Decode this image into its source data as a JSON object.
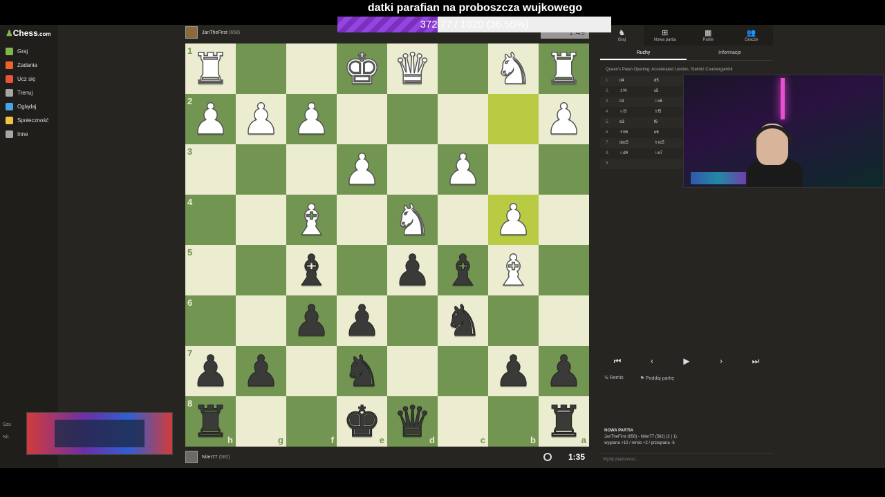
{
  "overlay": {
    "donation_title": "datki parafian na proboszcza wujkowego",
    "donation_progress_text": "372.77 / 1020 (36.55%)",
    "donation_progress_fraction": 0.3655
  },
  "sidebar": {
    "logo_prefix": "Chess",
    "logo_suffix": ".com",
    "items": [
      {
        "label": "Graj",
        "icon": "play-icon",
        "color": "#81b64c"
      },
      {
        "label": "Zadania",
        "icon": "puzzle-icon",
        "color": "#f1612a"
      },
      {
        "label": "Ucz się",
        "icon": "learn-icon",
        "color": "#e8533b"
      },
      {
        "label": "Trenuj",
        "icon": "train-icon",
        "color": "#a6a6a6"
      },
      {
        "label": "Oglądaj",
        "icon": "watch-icon",
        "color": "#4ca3e1"
      },
      {
        "label": "Społeczność",
        "icon": "community-icon",
        "color": "#efc34a"
      },
      {
        "label": "Inne",
        "icon": "more-icon",
        "color": "#a6a6a6"
      }
    ],
    "bottom": [
      "Szu",
      "Nit"
    ]
  },
  "top_player": {
    "name": "JanTheFirst",
    "rating": "(658)",
    "clock": "1:49"
  },
  "bottom_player": {
    "name": "Niter77",
    "rating": "(582)",
    "clock": "1:35"
  },
  "board": {
    "ranks": [
      "1",
      "2",
      "3",
      "4",
      "5",
      "6",
      "7",
      "8"
    ],
    "files": [
      "h",
      "g",
      "f",
      "e",
      "d",
      "c",
      "b",
      "a"
    ],
    "highlight": [
      [
        1,
        6
      ],
      [
        3,
        6
      ]
    ],
    "pieces": [
      [
        "wR",
        "",
        "",
        "wK",
        "wQ",
        "",
        "wN",
        "wR"
      ],
      [
        "wP",
        "wP",
        "wP",
        "",
        "",
        "",
        "",
        "wP"
      ],
      [
        "",
        "",
        "",
        "wP",
        "",
        "wP",
        "",
        ""
      ],
      [
        "",
        "",
        "wB",
        "",
        "wN",
        "",
        "wP",
        ""
      ],
      [
        "",
        "",
        "bB",
        "",
        "bP",
        "bB",
        "wB",
        ""
      ],
      [
        "",
        "",
        "bP",
        "bP",
        "",
        "bN",
        "",
        ""
      ],
      [
        "bP",
        "bP",
        "",
        "bN",
        "",
        "",
        "bP",
        "bP"
      ],
      [
        "bR",
        "",
        "",
        "bK",
        "bQ",
        "",
        "",
        "bR"
      ]
    ]
  },
  "panel": {
    "tabs": [
      {
        "label": "Graj",
        "icon": "play-icon"
      },
      {
        "label": "Nowa partia",
        "icon": "plus-icon"
      },
      {
        "label": "Partie",
        "icon": "games-icon"
      },
      {
        "label": "Gracze",
        "icon": "players-icon"
      }
    ],
    "subtabs": [
      "Ruchy",
      "Informacje"
    ],
    "opening": "Queen's Pawn Opening: Accelerated London, Steinitz Countergambit",
    "moves": [
      {
        "n": "1.",
        "w": "d4",
        "b": "d5"
      },
      {
        "n": "2.",
        "w": "♗f4",
        "b": "c5"
      },
      {
        "n": "3.",
        "w": "c3",
        "b": "♘c6"
      },
      {
        "n": "4.",
        "w": "♘f3",
        "b": "♗f5"
      },
      {
        "n": "5.",
        "w": "e3",
        "b": "f6"
      },
      {
        "n": "6.",
        "w": "♗b5",
        "b": "e6"
      },
      {
        "n": "7.",
        "w": "dxc5",
        "b": "♗xc5"
      },
      {
        "n": "8.",
        "w": "♘d4",
        "b": "♘e7"
      },
      {
        "n": "9.",
        "w": "",
        "b": ""
      }
    ],
    "controls": [
      "⏮",
      "‹",
      "▶",
      "›",
      "⏭"
    ],
    "draw_label": "Remis",
    "resign_label": "Poddaj partię",
    "newgame_heading": "NOWA PARTIA",
    "newgame_line1": "JanTheFirst (658) - Niter77 (582) (2 | 1)",
    "newgame_line2": "wygrana +10 / remis +2 / przegrana -6",
    "chat_placeholder": "Wyślij wiadomość..."
  }
}
